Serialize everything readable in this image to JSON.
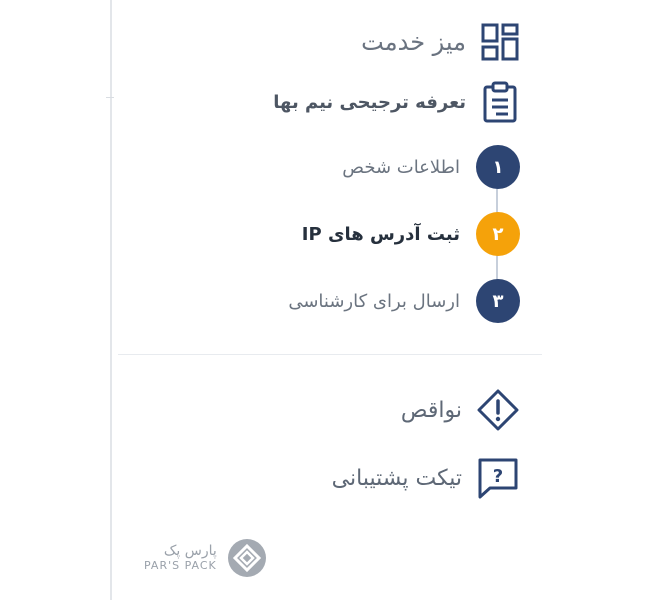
{
  "colors": {
    "primary": "#2d4573",
    "active": "#f5a20a",
    "text": "#5a6473",
    "muted": "#9aa1aa",
    "divider": "#e8ebef"
  },
  "menu": {
    "dashboard": {
      "label": "میز خدمت",
      "icon": "dashboard-grid-icon"
    },
    "tariff": {
      "label": "تعرفه ترجیحی نیم بها",
      "icon": "clipboard-icon"
    }
  },
  "steps": [
    {
      "number": "۱",
      "label": "اطلاعات شخص",
      "state": "done"
    },
    {
      "number": "۲",
      "label": "ثبت آدرس های IP",
      "state": "active"
    },
    {
      "number": "۳",
      "label": "ارسال برای کارشناسی",
      "state": "pending"
    }
  ],
  "secondary": {
    "deficits": {
      "label": "نواقص",
      "icon": "warning-diamond-icon"
    },
    "ticket": {
      "label": "تیکت پشتیبانی",
      "icon": "help-chat-icon"
    }
  },
  "brand": {
    "name_fa": "پارس پک",
    "name_en": "PAR'S PACK"
  }
}
